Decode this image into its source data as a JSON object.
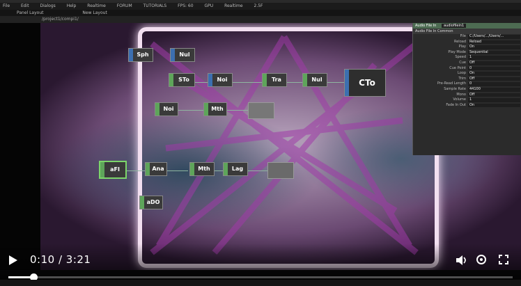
{
  "menubar": {
    "items": [
      "File",
      "Edit",
      "Dialogs",
      "Help",
      "Realtime",
      "FORUM",
      "TUTORIALS",
      "FPS: 60",
      "GPU",
      "Realtime",
      "2.5F"
    ]
  },
  "tabbar": {
    "left": "Panel Layout",
    "right": "New Layout"
  },
  "pathbar": {
    "text": "/project1/compi1/"
  },
  "nodes": [
    {
      "label": "Sph",
      "family": "chop"
    },
    {
      "label": "Nul",
      "family": "chop"
    },
    {
      "label": "STo",
      "family": "top"
    },
    {
      "label": "Noi",
      "family": "chop"
    },
    {
      "label": "Tra",
      "family": "top"
    },
    {
      "label": "Nul",
      "family": "top"
    },
    {
      "label": "CTo",
      "family": "chop"
    },
    {
      "label": "Noi",
      "family": "top"
    },
    {
      "label": "Mth",
      "family": "top"
    },
    {
      "label": "aFI",
      "family": "top"
    },
    {
      "label": "Ana",
      "family": "top"
    },
    {
      "label": "Mth",
      "family": "top"
    },
    {
      "label": "Lag",
      "family": "top"
    },
    {
      "label": "aDO",
      "family": "top"
    }
  ],
  "panel": {
    "title": "Audio File In",
    "name": "audiofilein1",
    "tabs": "Audio File In   Common",
    "params": [
      {
        "label": "File",
        "value": "C:/Users/.../Users/..."
      },
      {
        "label": "Reload",
        "value": "Reload"
      },
      {
        "label": "Play",
        "value": "On"
      },
      {
        "label": "Play Mode",
        "value": "Sequential"
      },
      {
        "label": "Speed",
        "value": "1"
      },
      {
        "label": "Cue",
        "value": "Off"
      },
      {
        "label": "Cue Point",
        "value": "0"
      },
      {
        "label": "Loop",
        "value": "On"
      },
      {
        "label": "Trim",
        "value": "Off"
      },
      {
        "label": "Pre-Read Length",
        "value": "0"
      },
      {
        "label": "Sample Rate",
        "value": "44100"
      },
      {
        "label": "Mono",
        "value": "Off"
      },
      {
        "label": "Volume",
        "value": "1"
      },
      {
        "label": "Fade In Out",
        "value": "On"
      }
    ]
  },
  "video": {
    "current_time": "0:10",
    "duration": "3:21",
    "progress": 0.05,
    "icons": [
      "play-icon",
      "volume-icon",
      "settings-icon",
      "fullscreen-icon"
    ]
  }
}
